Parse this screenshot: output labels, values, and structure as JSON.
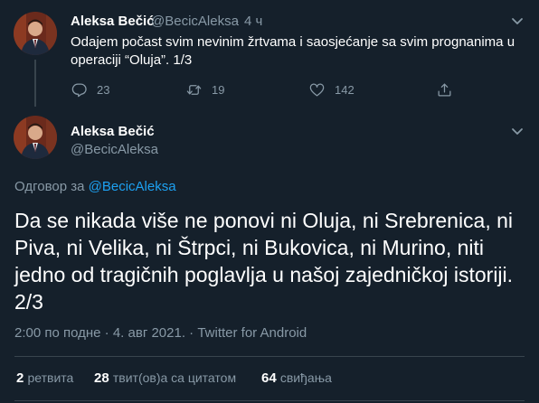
{
  "parent_tweet": {
    "name": "Aleksa Bečić",
    "handle": "@BecicAleksa",
    "separator": "·",
    "time": "4 ч",
    "text": "Odajem počast svim nevinim žrtvama i saosjećanje sa svim prognanima u operaciji “Oluja”. 1/3",
    "replies": "23",
    "retweets": "19",
    "likes": "142"
  },
  "main_tweet": {
    "name": "Aleksa Bečić",
    "handle": "@BecicAleksa",
    "reply_prefix": "Одговор за",
    "reply_handle": "@BecicAleksa",
    "text": "Da se nikada više ne ponovi ni Oluja, ni Srebrenica, ni Piva, ni Velika, ni Štrpci, ni Bukovica, ni Murino, niti jedno od tragičnih poglavlja u našoj zajedničkoj istoriji. 2/3",
    "meta": "2:00 по подне · 4. авг 2021. · Twitter for Android"
  },
  "stats": {
    "retweets_count": "2",
    "retweets_label": "ретвита",
    "quotes_count": "28",
    "quotes_label": "твит(ов)а са цитатом",
    "likes_count": "64",
    "likes_label": "свиђања"
  },
  "colors": {
    "background": "#15202b",
    "text": "#ffffff",
    "secondary": "#8899a6",
    "accent": "#1da1f2",
    "divider": "#38444d"
  }
}
